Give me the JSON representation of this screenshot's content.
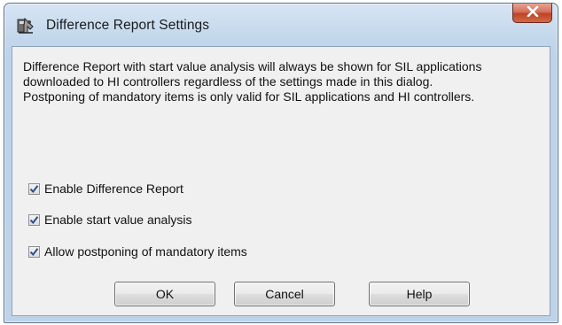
{
  "window": {
    "title": "Difference Report Settings",
    "app_icon": "settings-tool-icon",
    "close_icon": "close-icon"
  },
  "message": {
    "paragraph1": "Difference Report with start value analysis will always be shown for SIL applications downloaded to HI controllers regardless of the settings made in this dialog.",
    "paragraph2": "Postponing of mandatory items is only valid for SIL applications and HI controllers."
  },
  "options": [
    {
      "label": "Enable Difference Report",
      "checked": true
    },
    {
      "label": "Enable start value analysis",
      "checked": true
    },
    {
      "label": "Allow postponing of mandatory items",
      "checked": true
    }
  ],
  "buttons": {
    "ok": "OK",
    "cancel": "Cancel",
    "help": "Help"
  },
  "colors": {
    "close_button": "#c74a2e",
    "check_mark": "#2a4f8a",
    "title_bar": "#c3d7ec",
    "client_background": "#f0f0f0"
  }
}
